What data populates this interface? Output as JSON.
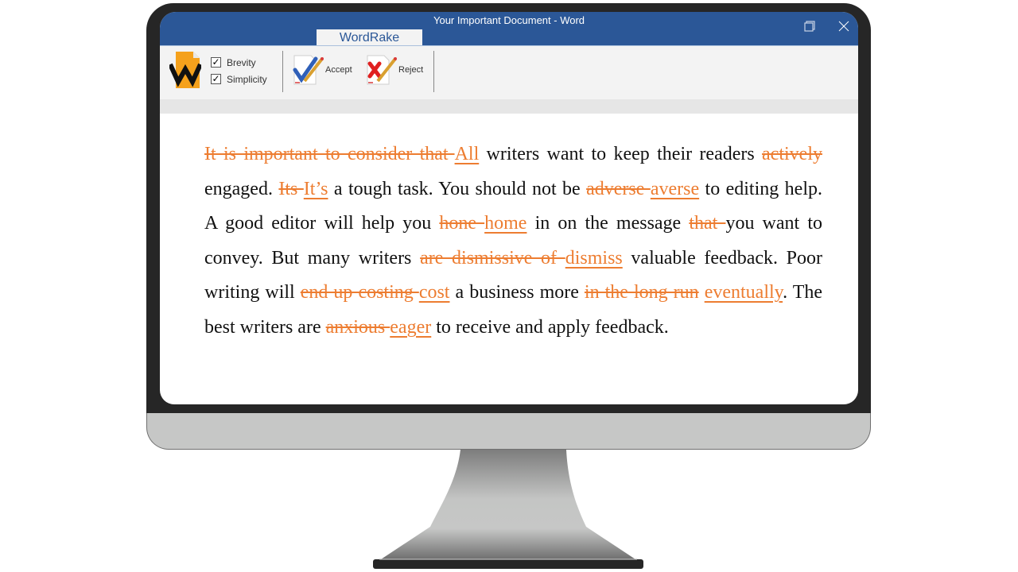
{
  "window": {
    "title": "Your Important Document - Word",
    "restore_icon": "restore-icon",
    "close_icon": "close-icon"
  },
  "ribbon": {
    "active_tab": "WordRake",
    "logo_icon": "wordrake-logo-icon",
    "options": [
      {
        "label": "Brevity",
        "checked": true,
        "mark": "✓"
      },
      {
        "label": "Simplicity",
        "checked": true,
        "mark": "✓"
      }
    ],
    "accept_label": "Accept",
    "reject_label": "Reject"
  },
  "colors": {
    "titlebar": "#2b5797",
    "revision": "#ed7d31",
    "bezel": "#262626"
  },
  "document": {
    "segments": [
      {
        "type": "del",
        "text": "It is important to consider that "
      },
      {
        "type": "ins",
        "text": "All"
      },
      {
        "type": "text",
        "text": " writers want to keep their readers "
      },
      {
        "type": "del",
        "text": "actively"
      },
      {
        "type": "text",
        "text": " engaged. "
      },
      {
        "type": "del",
        "text": "Its "
      },
      {
        "type": "ins",
        "text": "It’s"
      },
      {
        "type": "text",
        "text": " a tough task. You should not be "
      },
      {
        "type": "del",
        "text": "adverse "
      },
      {
        "type": "ins",
        "text": "averse"
      },
      {
        "type": "text",
        "text": " to editing help. A good editor will help you "
      },
      {
        "type": "del",
        "text": "hone "
      },
      {
        "type": "ins",
        "text": "home"
      },
      {
        "type": "text",
        "text": " in on the message "
      },
      {
        "type": "del",
        "text": "that "
      },
      {
        "type": "text",
        "text": "you want to convey. But many writers "
      },
      {
        "type": "del",
        "text": "are dismissive of "
      },
      {
        "type": "ins",
        "text": "dismiss"
      },
      {
        "type": "text",
        "text": " valuable feedback. Poor writing will "
      },
      {
        "type": "del",
        "text": "end up costing "
      },
      {
        "type": "ins",
        "text": "cost"
      },
      {
        "type": "text",
        "text": " a business more "
      },
      {
        "type": "del",
        "text": "in the long run"
      },
      {
        "type": "text",
        "text": " "
      },
      {
        "type": "ins",
        "text": "eventually"
      },
      {
        "type": "text",
        "text": ". The best writers are "
      },
      {
        "type": "del",
        "text": "anxious "
      },
      {
        "type": "ins",
        "text": "eager"
      },
      {
        "type": "text",
        "text": " to receive and apply feedback."
      }
    ]
  }
}
